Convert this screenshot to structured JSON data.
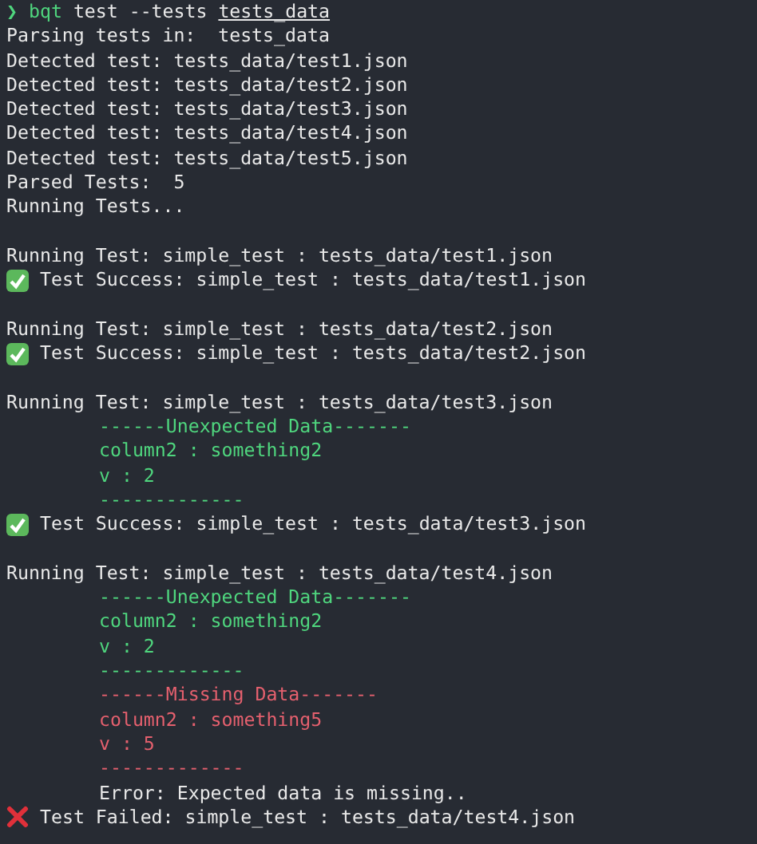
{
  "prompt": {
    "symbol": "❯",
    "program": "bqt",
    "args": "test --tests",
    "path": "tests_data"
  },
  "lines": [
    {
      "kind": "plain",
      "text": "Parsing tests in:  tests_data"
    },
    {
      "kind": "plain",
      "text": "Detected test: tests_data/test1.json"
    },
    {
      "kind": "plain",
      "text": "Detected test: tests_data/test2.json"
    },
    {
      "kind": "plain",
      "text": "Detected test: tests_data/test3.json"
    },
    {
      "kind": "plain",
      "text": "Detected test: tests_data/test4.json"
    },
    {
      "kind": "plain",
      "text": "Detected test: tests_data/test5.json"
    },
    {
      "kind": "plain",
      "text": "Parsed Tests:  5"
    },
    {
      "kind": "plain",
      "text": "Running Tests..."
    },
    {
      "kind": "blank"
    },
    {
      "kind": "plain",
      "text": "Running Test: simple_test : tests_data/test1.json"
    },
    {
      "kind": "success",
      "text": "Test Success: simple_test : tests_data/test1.json"
    },
    {
      "kind": "blank"
    },
    {
      "kind": "plain",
      "text": "Running Test: simple_test : tests_data/test2.json"
    },
    {
      "kind": "success",
      "text": "Test Success: simple_test : tests_data/test2.json"
    },
    {
      "kind": "blank"
    },
    {
      "kind": "plain",
      "text": "Running Test: simple_test : tests_data/test3.json"
    },
    {
      "kind": "unexpected",
      "text": "------Unexpected Data-------"
    },
    {
      "kind": "unexpected",
      "text": "column2 : something2"
    },
    {
      "kind": "unexpected",
      "text": "v : 2"
    },
    {
      "kind": "unexpected",
      "text": "-------------"
    },
    {
      "kind": "success",
      "text": "Test Success: simple_test : tests_data/test3.json"
    },
    {
      "kind": "blank"
    },
    {
      "kind": "plain",
      "text": "Running Test: simple_test : tests_data/test4.json"
    },
    {
      "kind": "unexpected",
      "text": "------Unexpected Data-------"
    },
    {
      "kind": "unexpected",
      "text": "column2 : something2"
    },
    {
      "kind": "unexpected",
      "text": "v : 2"
    },
    {
      "kind": "unexpected",
      "text": "-------------"
    },
    {
      "kind": "missing",
      "text": "------Missing Data-------"
    },
    {
      "kind": "missing",
      "text": "column2 : something5"
    },
    {
      "kind": "missing",
      "text": "v : 5"
    },
    {
      "kind": "missing",
      "text": "-------------"
    },
    {
      "kind": "detail",
      "text": "Error: Expected data is missing.."
    },
    {
      "kind": "failure",
      "text": "Test Failed: simple_test : tests_data/test4.json"
    }
  ]
}
